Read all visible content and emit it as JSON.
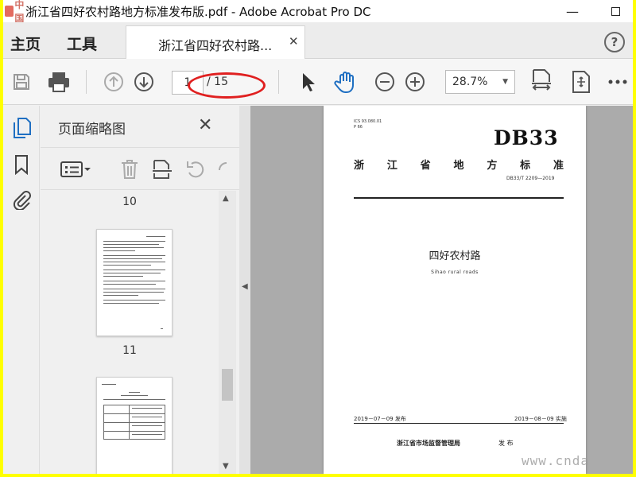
{
  "window": {
    "title": "浙江省四好农村路地方标准发布版.pdf - Adobe Acrobat Pro DC",
    "logo_text": "中国"
  },
  "tabs": {
    "home": "主页",
    "tools": "工具",
    "document": "浙江省四好农村路...",
    "help": "?"
  },
  "toolbar": {
    "current_page": "1",
    "total_pages": "/ 15",
    "zoom": "28.7%"
  },
  "thumbnails_panel": {
    "title": "页面缩略图",
    "pages": [
      {
        "label": "10"
      },
      {
        "label": "11"
      }
    ]
  },
  "document_page": {
    "ics": "ICS 93.080.01",
    "class_code": "P 66",
    "db_code": "DB33",
    "standard_chars": [
      "浙",
      "江",
      "省",
      "地",
      "方",
      "标",
      "准"
    ],
    "standard_number": "DB33/T 2209—2019",
    "title_cn": "四好农村路",
    "title_en": "Sihao rural roads",
    "publish_date": "2019－07－09 发布",
    "implement_date": "2019－08－09 实施",
    "issuer": "浙江省市场监督管理局",
    "issue_word": "发 布"
  },
  "watermark": "www.cnda",
  "colors": {
    "frame": "#ffff00",
    "annotation_ellipse": "#e02020",
    "accent_blue": "#1f6fc2"
  }
}
